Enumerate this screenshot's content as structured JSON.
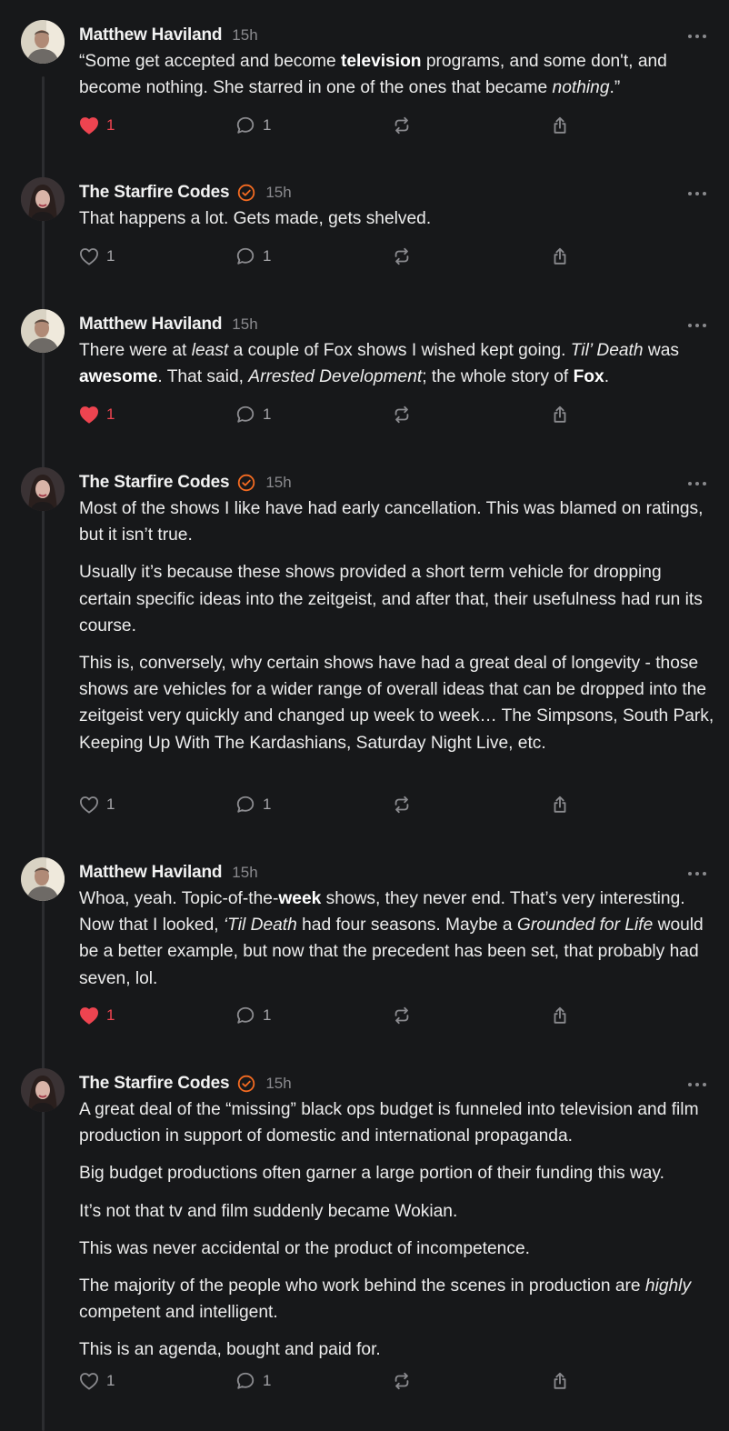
{
  "posts": [
    {
      "author": "Matthew Haviland",
      "verified": false,
      "time": "15h",
      "avatar_icon": "person-avatar-icon",
      "paragraphs": [
        "“Some get accepted and become <b>television</b> programs, and some don't, and become nothing. She starred in one of the ones that became <i>nothing</i>.”"
      ],
      "likes": "1",
      "liked": true,
      "replies": "1"
    },
    {
      "author": "The Starfire Codes",
      "verified": true,
      "time": "15h",
      "avatar_icon": "woman-avatar-icon",
      "paragraphs": [
        "That happens a lot. Gets made, gets shelved."
      ],
      "likes": "1",
      "liked": false,
      "replies": "1"
    },
    {
      "author": "Matthew Haviland",
      "verified": false,
      "time": "15h",
      "avatar_icon": "person-avatar-icon",
      "paragraphs": [
        "There were at <i>least</i> a couple of Fox shows I wished kept going. <i>Til’ Death</i> was <b>awesome</b>. That said, <i>Arrested Development</i>; the whole story of <b>Fox</b>."
      ],
      "likes": "1",
      "liked": true,
      "replies": "1"
    },
    {
      "author": "The Starfire Codes",
      "verified": true,
      "time": "15h",
      "avatar_icon": "woman-avatar-icon",
      "paragraphs": [
        "Most of the shows I like have had early cancellation. This was blamed on ratings, but it isn’t true.",
        "Usually it’s because these shows provided a short term vehicle for dropping certain specific ideas into the zeitgeist, and after that, their usefulness had run its course.",
        "This is, conversely, why certain shows have had a great deal of longevity - those shows are vehicles for a wider range of overall ideas that can be dropped into the zeitgeist very quickly and changed up week to week… The Simpsons, South Park, Keeping Up With The Kardashians, Saturday Night Live, etc."
      ],
      "likes": "1",
      "liked": false,
      "replies": "1"
    },
    {
      "author": "Matthew Haviland",
      "verified": false,
      "time": "15h",
      "avatar_icon": "person-avatar-icon",
      "paragraphs": [
        "Whoa, yeah. Topic-of-the-<b>week</b> shows, they never end. That’s very interesting. Now that I looked, <i>‘Til Death</i> had four seasons. Maybe a <i>Grounded for Life</i> would be a better example, but now that the precedent has been set, that probably had seven, lol."
      ],
      "likes": "1",
      "liked": true,
      "replies": "1"
    },
    {
      "author": "The Starfire Codes",
      "verified": true,
      "time": "15h",
      "avatar_icon": "woman-avatar-icon",
      "paragraphs": [
        "A great deal of the “missing” black ops budget is funneled into television and film production in support of domestic and international propaganda.",
        "Big budget productions often garner a large portion of their funding this way.",
        "It’s not that tv and film suddenly became Wokian.",
        "This was never accidental or the product of incompetence.",
        "The majority of the people who work behind the scenes in production are <i>highly</i> competent and intelligent.",
        "This is an agenda, bought and paid for."
      ],
      "likes": "1",
      "liked": false,
      "replies": "1"
    }
  ],
  "icons": {
    "like": "heart-icon",
    "reply": "comment-icon",
    "repost": "repost-icon",
    "share": "share-icon",
    "more": "more-options-icon",
    "verified": "verified-badge-icon"
  },
  "colors": {
    "background": "#17181a",
    "liked": "#ee4450",
    "verified": "#f26a21",
    "muted": "#8a8a8e"
  }
}
